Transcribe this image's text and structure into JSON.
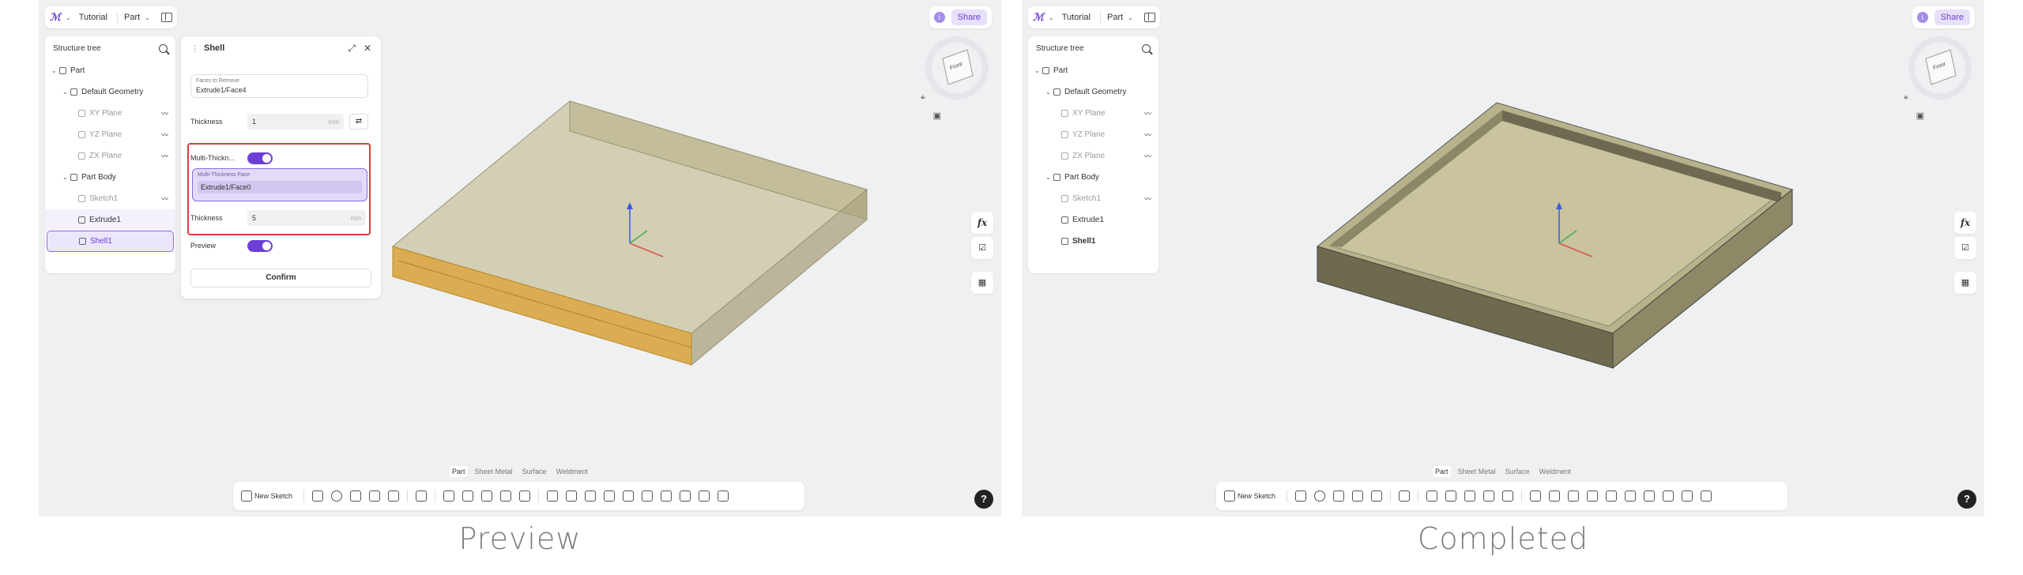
{
  "captions": {
    "preview": "Preview",
    "completed": "Completed"
  },
  "topbar": {
    "tutorial": "Tutorial",
    "part": "Part"
  },
  "share_label": "Share",
  "tree": {
    "title": "Structure tree",
    "items": [
      {
        "label": "Part"
      },
      {
        "label": "Default Geometry"
      },
      {
        "label": "XY Plane"
      },
      {
        "label": "YZ Plane"
      },
      {
        "label": "ZX Plane"
      },
      {
        "label": "Part Body"
      },
      {
        "label": "Sketch1"
      },
      {
        "label": "Extrude1"
      },
      {
        "label": "Shell1"
      }
    ]
  },
  "shell_dialog": {
    "title": "Shell",
    "faces_label": "Faces to Remove",
    "faces_value": "Extrude1/Face4",
    "thickness_label": "Thickness",
    "thickness_value": "1",
    "unit": "mm",
    "multi_label": "Multi-Thickn...",
    "mt_face_label": "Multi-Thickness Face",
    "mt_face_value": "Extrude1/Face0",
    "mt_thickness_label": "Thickness",
    "mt_thickness_value": "5",
    "preview_label": "Preview",
    "confirm_label": "Confirm"
  },
  "bottom_tabs": [
    "Part",
    "Sheet Metal",
    "Surface",
    "Weldment"
  ],
  "new_sketch_label": "New Sketch",
  "right_tools": {
    "fx": "fx"
  },
  "help": "?",
  "colors": {
    "accent": "#6b3fd6",
    "highlight_box": "#e23a3a",
    "selected_face": "#d9a441"
  }
}
